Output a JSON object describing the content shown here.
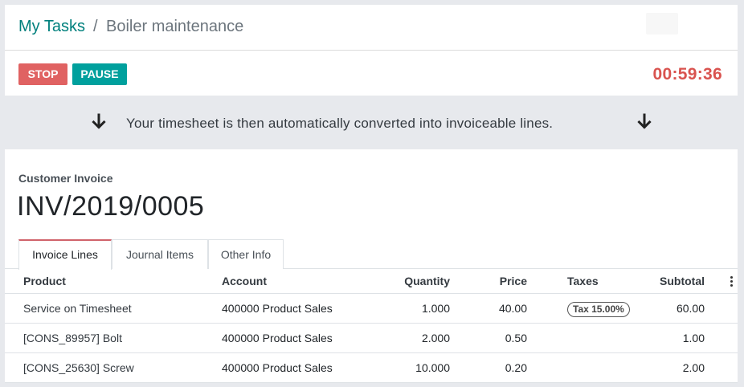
{
  "breadcrumb": {
    "parent": "My Tasks",
    "separator": "/",
    "current": "Boiler maintenance"
  },
  "timer": {
    "stop_label": "STOP",
    "pause_label": "PAUSE",
    "elapsed": "00:59:36"
  },
  "message": {
    "text": "Your timesheet is then automatically converted into invoiceable lines."
  },
  "invoice": {
    "label": "Customer Invoice",
    "number": "INV/2019/0005"
  },
  "tabs": [
    {
      "label": "Invoice Lines"
    },
    {
      "label": "Journal Items"
    },
    {
      "label": "Other Info"
    }
  ],
  "table": {
    "headers": {
      "product": "Product",
      "account": "Account",
      "quantity": "Quantity",
      "price": "Price",
      "taxes": "Taxes",
      "subtotal": "Subtotal"
    },
    "rows": [
      {
        "product": "Service on Timesheet",
        "account": "400000 Product Sales",
        "quantity": "1.000",
        "price": "40.00",
        "taxes": "Tax 15.00%",
        "subtotal": "60.00"
      },
      {
        "product": "[CONS_89957] Bolt",
        "account": "400000 Product Sales",
        "quantity": "2.000",
        "price": "0.50",
        "taxes": "",
        "subtotal": "1.00"
      },
      {
        "product": "[CONS_25630] Screw",
        "account": "400000 Product Sales",
        "quantity": "10.000",
        "price": "0.20",
        "taxes": "",
        "subtotal": "2.00"
      }
    ]
  },
  "icons": {
    "arrow": "arrow-down-icon",
    "options": "kebab-menu-icon"
  },
  "colors": {
    "brand": "#00807d",
    "stop": "#e06262",
    "pause": "#00a09d",
    "timer": "#d9534f",
    "tab_accent": "#d0636b"
  }
}
